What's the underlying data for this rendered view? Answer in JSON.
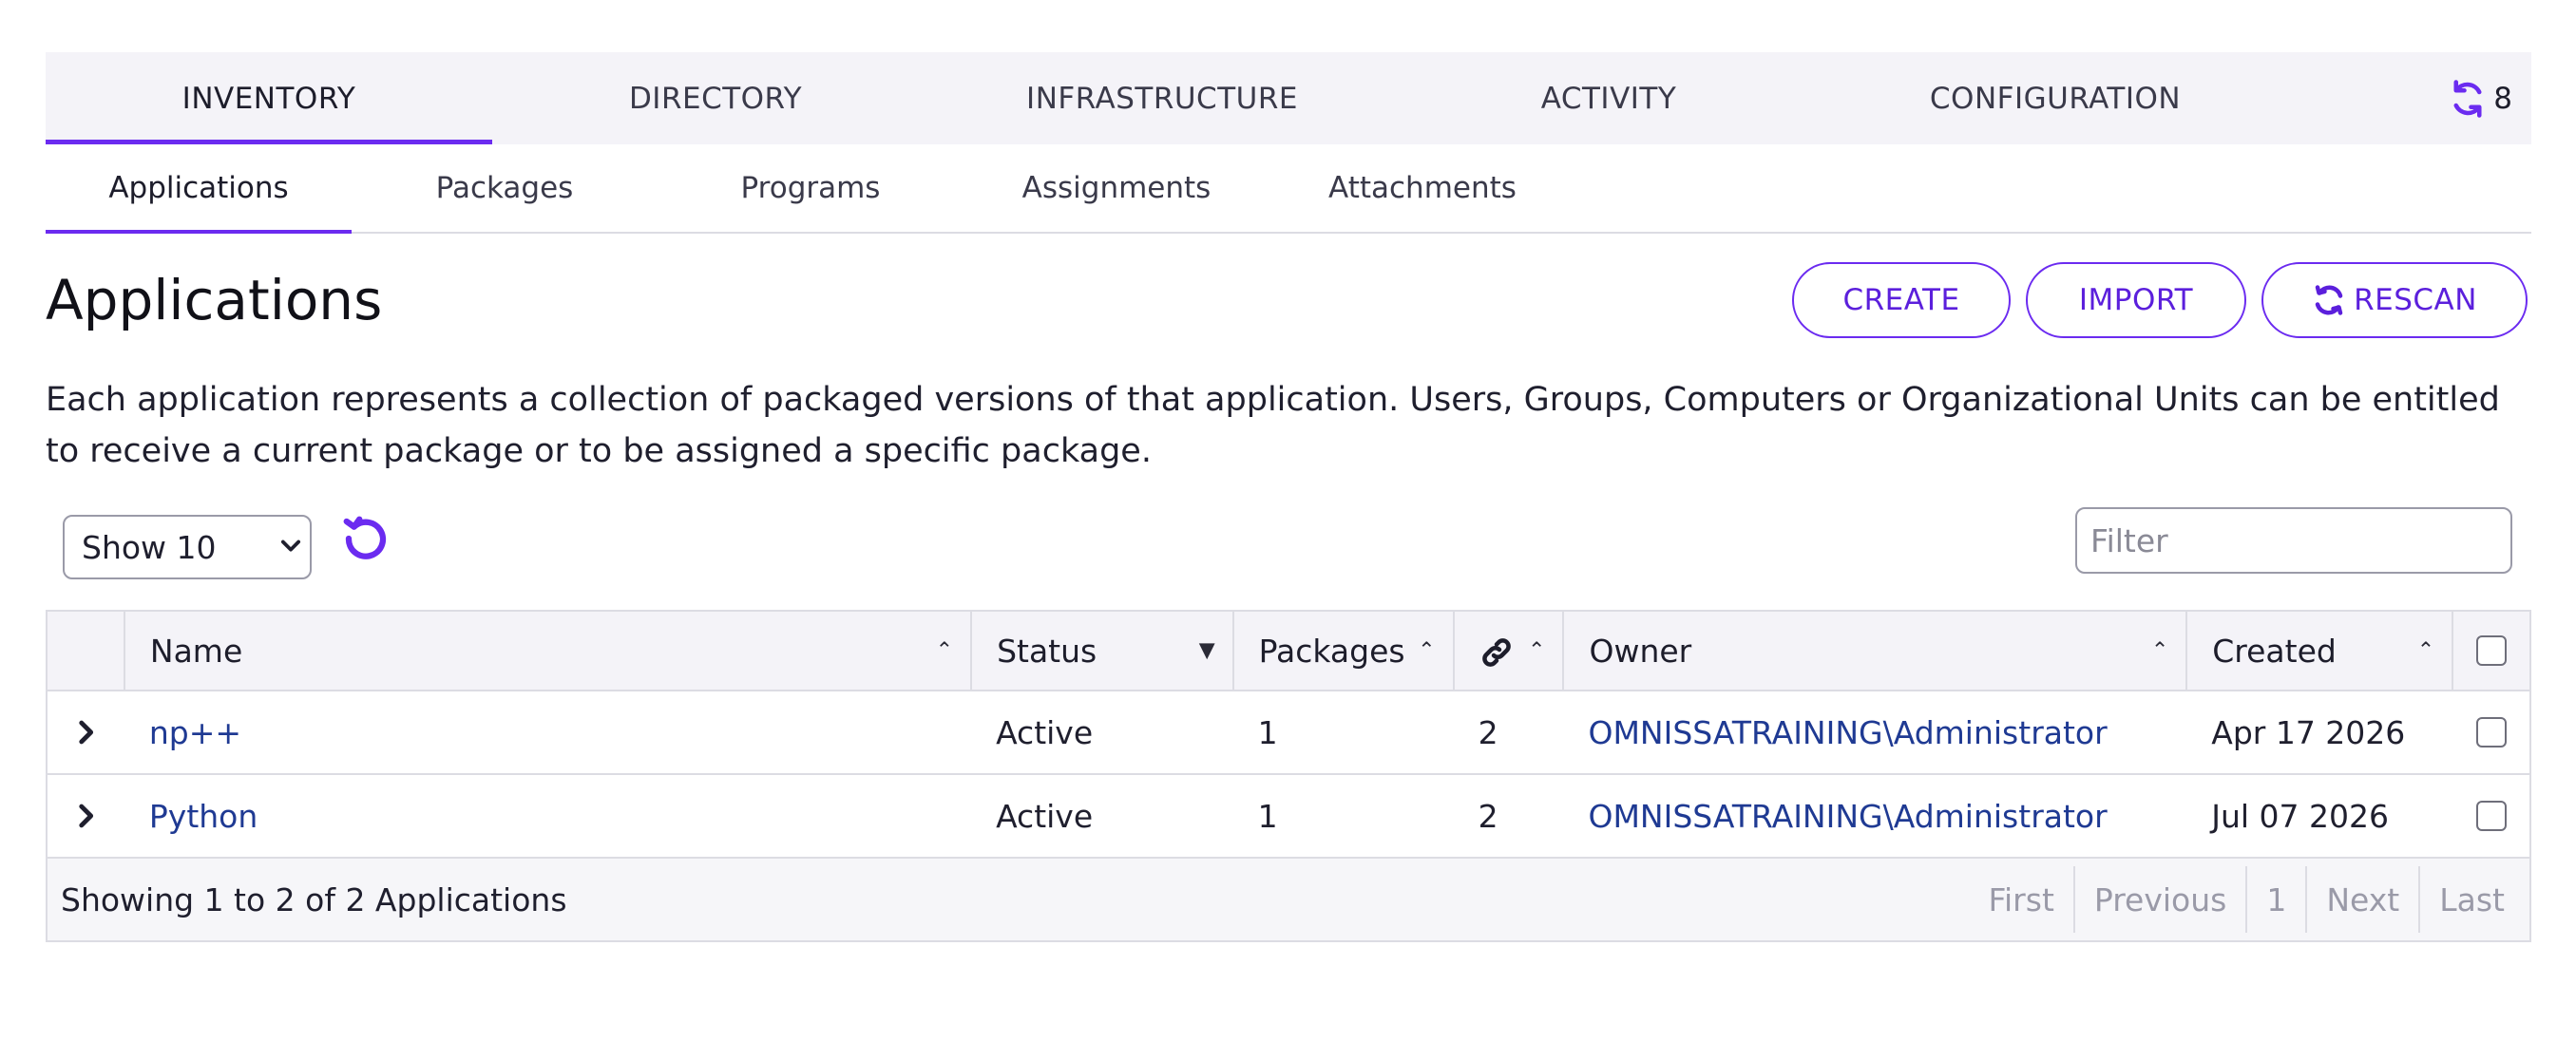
{
  "topnav": {
    "tabs": [
      "INVENTORY",
      "DIRECTORY",
      "INFRASTRUCTURE",
      "ACTIVITY",
      "CONFIGURATION"
    ],
    "sync_count": "8"
  },
  "subtabs": [
    "Applications",
    "Packages",
    "Programs",
    "Assignments",
    "Attachments"
  ],
  "page": {
    "title": "Applications",
    "description": "Each application represents a collection of packaged versions of that application. Users, Groups, Computers or Organizational Units can be entitled to receive a current package or to be assigned a specific package."
  },
  "buttons": {
    "create": "CREATE",
    "import": "IMPORT",
    "rescan": "RESCAN"
  },
  "controls": {
    "show_selected": "Show 10",
    "filter_placeholder": "Filter"
  },
  "table": {
    "columns": {
      "name": "Name",
      "status": "Status",
      "packages": "Packages",
      "owner": "Owner",
      "created": "Created"
    },
    "rows": [
      {
        "name": "np++",
        "status": "Active",
        "packages": "1",
        "links": "2",
        "owner": "OMNISSATRAINING\\Administrator",
        "created": "Apr 17 2026"
      },
      {
        "name": "Python",
        "status": "Active",
        "packages": "1",
        "links": "2",
        "owner": "OMNISSATRAINING\\Administrator",
        "created": "Jul 07 2026"
      }
    ]
  },
  "footer": {
    "summary": "Showing 1 to 2 of 2 Applications",
    "pager": {
      "first": "First",
      "previous": "Previous",
      "page": "1",
      "next": "Next",
      "last": "Last"
    }
  },
  "colors": {
    "accent": "#6b2bf0",
    "link": "#1f3a93"
  }
}
